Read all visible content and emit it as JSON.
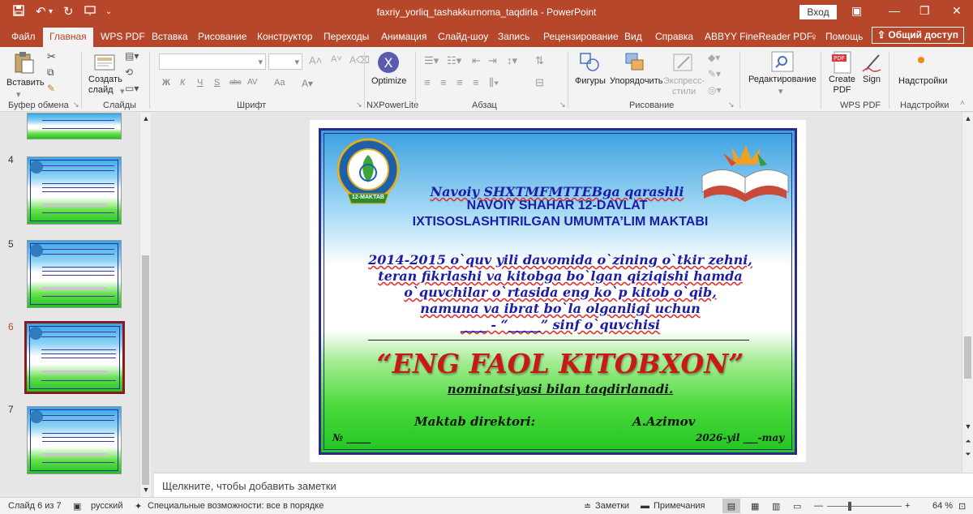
{
  "window": {
    "title": "faxriy_yorliq_tashakkurnoma_taqdirla  -  PowerPoint",
    "login_label": "Вход",
    "share_label": "Общий доступ"
  },
  "tabs": [
    "Файл",
    "Главная",
    "WPS PDF",
    "Вставка",
    "Рисование",
    "Конструктор",
    "Переходы",
    "Анимация",
    "Слайд-шоу",
    "Запись",
    "Рецензирование",
    "Вид",
    "Справка",
    "ABBYY FineReader PDF",
    "Помощь"
  ],
  "ribbon": {
    "paste": "Вставить",
    "create_slide": [
      "Создать",
      "слайд"
    ],
    "optimize": "Optimize",
    "shapes": "Фигуры",
    "arrange": "Упорядочить",
    "quick_styles": [
      "Экспресс-",
      "стили"
    ],
    "editing": "Редактирование",
    "create_pdf": [
      "Create",
      "PDF"
    ],
    "sign": "Sign",
    "addins": "Надстройки",
    "font_buttons": [
      "Ж",
      "К",
      "Ч",
      "S",
      "abc",
      "AV",
      "Aa"
    ],
    "groups": [
      "Буфер обмена",
      "Слайды",
      "Шрифт",
      "NXPowerLite",
      "Абзац",
      "Рисование",
      "WPS PDF",
      "Надстройки"
    ]
  },
  "thumbnails": {
    "numbers": [
      "4",
      "5",
      "6",
      "7"
    ],
    "selected": "6"
  },
  "slide": {
    "line1": "Navoiy SHXTMFMTTEBga qarashli",
    "line2": "NAVOIY SHAHAR 12-DAVLAT",
    "line3": "IXTISOSLASHTIRILGAN  UMUMTA’LIM MAKTABI",
    "body": [
      "2014-2015 o`quv yili davomida o`zining o`tkir zehni,",
      "teran fikrlashi va kitobga bo`lgan qiziqishi hamda",
      "o`quvchilar o`rtasida eng ko`p kitob o`qib,",
      "namuna va ibrat bo`la olganligi uchun",
      "____ - “_____”  sinf o`quvchisi"
    ],
    "headline": "“ENG FAOL KITOBXON”",
    "subline": "nominatsiyasi bilan taqdirlanadi.",
    "director_label": "Maktab direktori:",
    "director_name": "A.Azimov",
    "number_label": "№ _____",
    "date": "2026-yil ___-may",
    "emblem_text": "12-MAKTAB"
  },
  "notes_placeholder": "Щелкните, чтобы добавить заметки",
  "status": {
    "slide_of": "Слайд 6 из 7",
    "language": "русский",
    "accessibility": "Специальные возможности: все в порядке",
    "notes_btn": "Заметки",
    "comments_btn": "Примечания",
    "zoom": "64 %"
  },
  "colors": {
    "accent": "#b7472a",
    "cert_text": "#1c1ca8",
    "headline": "#c81818"
  }
}
